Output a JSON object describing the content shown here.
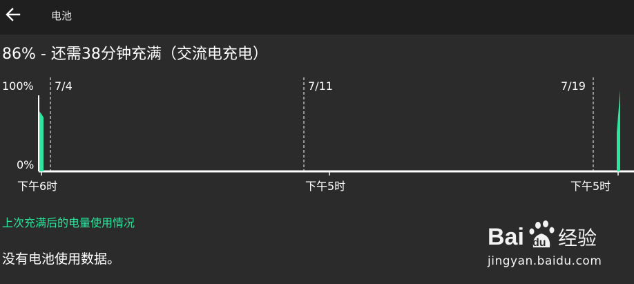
{
  "header": {
    "title": "电池",
    "back_icon": "arrow-left-icon"
  },
  "battery": {
    "status": "86% - 还需38分钟充满（交流电充电）",
    "level_percent": 86
  },
  "chart_data": {
    "type": "area",
    "y_tick_labels": [
      "100%",
      "0%"
    ],
    "ylim": [
      0,
      100
    ],
    "date_markers": [
      "7/4",
      "7/11",
      "7/19"
    ],
    "x_tick_labels": [
      "下午6时",
      "下午5时",
      "下午5时"
    ],
    "series_color": "#2ee59d",
    "series": [
      {
        "segment": "start",
        "values": [
          70,
          67,
          63
        ]
      },
      {
        "segment": "end",
        "values": [
          45,
          70,
          95
        ]
      }
    ],
    "grid": false
  },
  "usage": {
    "section_title": "上次充满后的电量使用情况",
    "empty_message": "没有电池使用数据。"
  },
  "watermark": {
    "logo_text_left": "Bai",
    "logo_text_right": "du",
    "logo_suffix": "经验",
    "url": "jingyan.baidu.com"
  },
  "colors": {
    "background": "#2b2b2b",
    "toolbar": "#1f1f1f",
    "accent": "#2ee59d"
  }
}
